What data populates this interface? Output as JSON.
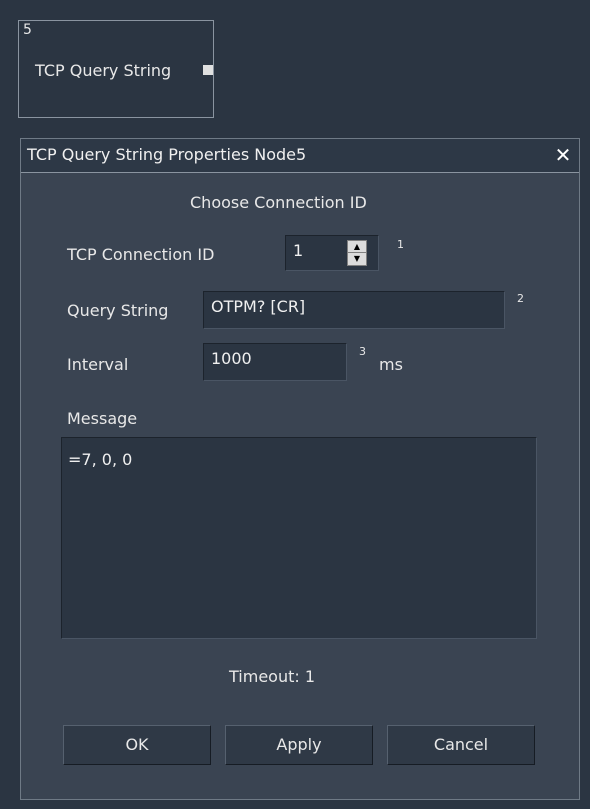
{
  "node": {
    "number": "5",
    "label": "TCP Query String"
  },
  "dialog": {
    "title": "TCP Query String Properties Node5",
    "close_glyph": "✕",
    "heading": "Choose Connection ID",
    "connection_id": {
      "label": "TCP Connection ID",
      "value": "1",
      "marker": "1"
    },
    "query_string": {
      "label": "Query String",
      "value": "OTPM? [CR]",
      "marker": "2"
    },
    "interval": {
      "label": "Interval",
      "value": "1000",
      "marker": "3",
      "unit": "ms"
    },
    "message": {
      "label": "Message",
      "value": "=7, 0, 0"
    },
    "timeout": "Timeout:  1",
    "buttons": {
      "ok": "OK",
      "apply": "Apply",
      "cancel": "Cancel"
    }
  },
  "icons": {
    "close": "close-icon",
    "spin_up": "spin-up-icon",
    "spin_down": "spin-down-icon"
  }
}
